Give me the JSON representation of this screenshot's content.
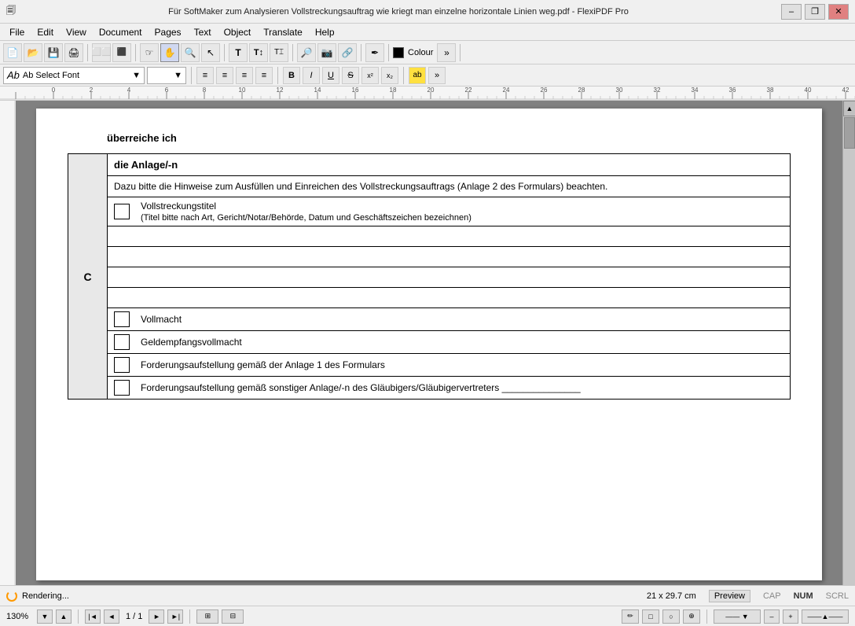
{
  "titlebar": {
    "title": "Für SoftMaker zum Analysieren Vollstreckungsauftrag wie kriegt man einzelne horizontale Linien weg.pdf - FlexiPDF Pro",
    "minimize_label": "–",
    "restore_label": "❐",
    "close_label": "✕"
  },
  "menubar": {
    "items": [
      "File",
      "Edit",
      "View",
      "Document",
      "Pages",
      "Text",
      "Object",
      "Translate",
      "Help"
    ]
  },
  "toolbar2": {
    "font_select_label": "Ab Select Font",
    "font_size": "",
    "bold": "B",
    "italic": "I",
    "underline": "U",
    "strikethrough": "S",
    "superscript": "x²",
    "subscript": "x₂"
  },
  "statusbar": {
    "rendering": "Rendering...",
    "page_size": "21 x 29.7 cm",
    "preview": "Preview",
    "caps": "CAP",
    "num": "NUM",
    "scrl": "SCRL"
  },
  "bottombar": {
    "zoom": "130%",
    "page_info": "1 / 1"
  },
  "document": {
    "intro_text": "überreiche ich",
    "section_c_label": "C",
    "section_header": "die Anlage/-n",
    "section_note": "Dazu bitte die Hinweise zum Ausfüllen und Einreichen des Vollstreckungsauftrags (Anlage 2 des Formulars) beachten.",
    "rows": [
      {
        "has_checkbox": true,
        "text": "Vollstreckungstitel\n(Titel bitte nach Art, Gericht/Notar/Behörde, Datum und Geschäftszeichen bezeichnen)",
        "empty": false
      },
      {
        "has_checkbox": false,
        "text": "",
        "empty": true
      },
      {
        "has_checkbox": false,
        "text": "",
        "empty": true
      },
      {
        "has_checkbox": false,
        "text": "",
        "empty": true
      },
      {
        "has_checkbox": false,
        "text": "",
        "empty": true
      },
      {
        "has_checkbox": true,
        "text": "Vollmacht",
        "empty": false
      },
      {
        "has_checkbox": true,
        "text": "Geldempfangsvollmacht",
        "empty": false
      },
      {
        "has_checkbox": true,
        "text": "Forderungsaufstellung gemäß der Anlage 1 des Formulars",
        "empty": false
      },
      {
        "has_checkbox": true,
        "text": "Forderungsaufstellung gemäß sonstiger Anlage/-n des Gläubigers/Gläubigervertreters _______________",
        "empty": false
      }
    ]
  }
}
